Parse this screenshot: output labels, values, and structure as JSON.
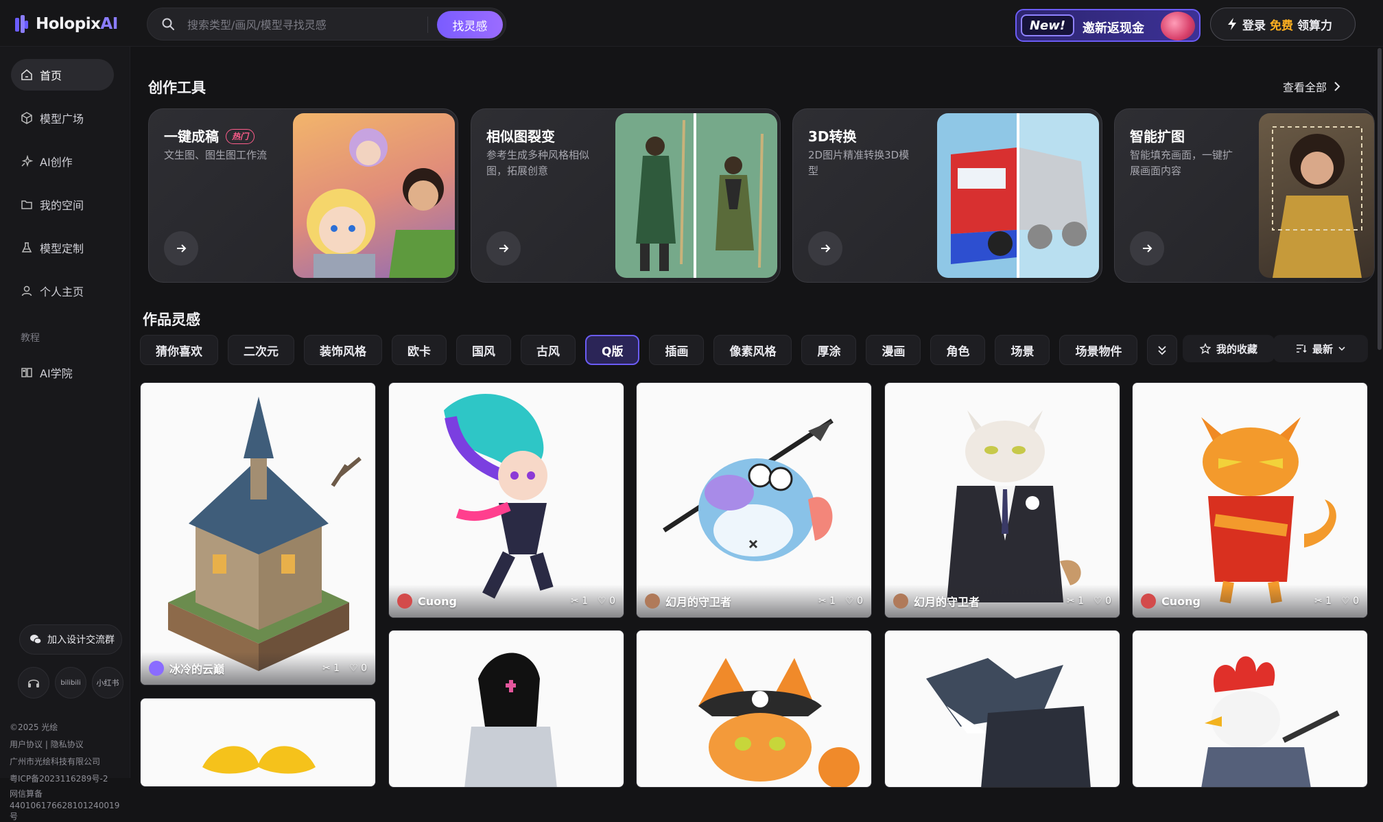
{
  "app": {
    "logo_main": "Holopix",
    "logo_accent": "AI"
  },
  "search": {
    "placeholder": "搜索类型/画风/模型寻找灵感",
    "button_label": "找灵感"
  },
  "invite": {
    "badge": "New!",
    "text": "邀新返现金"
  },
  "login": {
    "label": "登录",
    "free": "免费",
    "suffix": "领算力"
  },
  "sidebar": {
    "items": [
      {
        "label": "首页",
        "icon": "home-icon"
      },
      {
        "label": "模型广场",
        "icon": "cube-icon"
      },
      {
        "label": "AI创作",
        "icon": "sparkle-icon"
      },
      {
        "label": "我的空间",
        "icon": "folder-icon"
      },
      {
        "label": "模型定制",
        "icon": "flask-icon"
      },
      {
        "label": "个人主页",
        "icon": "user-icon"
      }
    ],
    "section_label": "教程",
    "academy": {
      "label": "AI学院",
      "icon": "book-icon"
    },
    "join_group": "加入设计交流群",
    "round_buttons": [
      "headset-icon",
      "bilibili",
      "小红书"
    ],
    "footer": [
      "©2025 光绘",
      "用户协议 | 隐私协议",
      "广州市光绘科技有限公司",
      "粤ICP备2023116289号-2",
      "网信算备",
      "440106176628101240019号"
    ]
  },
  "tools": {
    "title": "创作工具",
    "view_all": "查看全部",
    "cards": [
      {
        "title": "一键成稿",
        "badge": "热门",
        "desc": "文生图、图生图工作流"
      },
      {
        "title": "相似图裂变",
        "badge": "",
        "desc": "参考生成多种风格相似图，拓展创意"
      },
      {
        "title": "3D转换",
        "badge": "",
        "desc": "2D图片精准转换3D模型"
      },
      {
        "title": "智能扩图",
        "badge": "",
        "desc": "智能填充画面，一键扩展画面内容"
      }
    ]
  },
  "inspiration": {
    "title": "作品灵感",
    "filters": [
      "猜你喜欢",
      "二次元",
      "装饰风格",
      "欧卡",
      "国风",
      "古风",
      "Q版",
      "插画",
      "像素风格",
      "厚涂",
      "漫画",
      "角色",
      "场景",
      "场景物件"
    ],
    "active_filter": "Q版",
    "favorites": "我的收藏",
    "sort": "最新"
  },
  "works": [
    {
      "author": "冰冷的云巅",
      "remixes": "1",
      "likes": "0",
      "avatar_color": "#8a6cff"
    },
    {
      "author": "Cuong",
      "remixes": "1",
      "likes": "0",
      "avatar_color": "#d34b4b"
    },
    {
      "author": "幻月的守卫者",
      "remixes": "1",
      "likes": "0",
      "avatar_color": "#b07a5a"
    },
    {
      "author": "幻月的守卫者",
      "remixes": "1",
      "likes": "0",
      "avatar_color": "#b07a5a"
    },
    {
      "author": "Cuong",
      "remixes": "1",
      "likes": "0",
      "avatar_color": "#d34b4b"
    }
  ],
  "colors": {
    "accent": "#6b5cf5",
    "hot": "#ff5d8b",
    "free": "#ffb020"
  }
}
